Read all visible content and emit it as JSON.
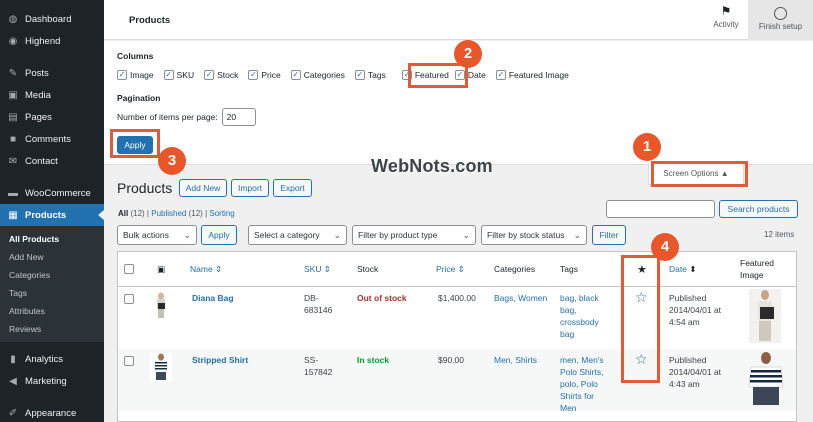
{
  "sidebar": {
    "items": [
      {
        "label": "Dashboard",
        "icon": "dashboard-icon"
      },
      {
        "label": "Highend",
        "icon": "palette-icon"
      },
      {
        "label": "Posts",
        "icon": "pin-icon"
      },
      {
        "label": "Media",
        "icon": "media-icon"
      },
      {
        "label": "Pages",
        "icon": "page-icon"
      },
      {
        "label": "Comments",
        "icon": "comment-icon"
      },
      {
        "label": "Contact",
        "icon": "mail-icon"
      },
      {
        "label": "WooCommerce",
        "icon": "woo-icon"
      },
      {
        "label": "Products",
        "icon": "box-icon"
      }
    ],
    "submenu": [
      "All Products",
      "Add New",
      "Categories",
      "Tags",
      "Attributes",
      "Reviews"
    ],
    "bottom_items": [
      {
        "label": "Analytics",
        "icon": "bar-chart-icon"
      },
      {
        "label": "Marketing",
        "icon": "megaphone-icon"
      },
      {
        "label": "Appearance",
        "icon": "brush-icon"
      }
    ]
  },
  "topbar": {
    "title": "Products",
    "activity": "Activity",
    "finish_setup": "Finish setup"
  },
  "screen_options": {
    "columns_heading": "Columns",
    "columns": [
      "Image",
      "SKU",
      "Stock",
      "Price",
      "Categories",
      "Tags",
      "Featured",
      "Date",
      "Featured Image"
    ],
    "pagination_heading": "Pagination",
    "per_page_label": "Number of items per page:",
    "per_page_value": "20",
    "apply": "Apply"
  },
  "annotations": [
    "1",
    "2",
    "3",
    "4"
  ],
  "watermark": "WebNots.com",
  "screen_options_tab": "Screen Options",
  "main": {
    "heading": "Products",
    "buttons": [
      "Add New",
      "Import",
      "Export"
    ],
    "filters": {
      "all": "All",
      "all_count": "(12)",
      "published": "Published",
      "published_count": "(12)",
      "sorting": "Sorting"
    },
    "search_button": "Search products",
    "bulk_actions": "Bulk actions",
    "apply": "Apply",
    "category_select": "Select a category",
    "type_select": "Filter by product type",
    "stock_select": "Filter by stock status",
    "filter_button": "Filter",
    "items_count": "12 items"
  },
  "table": {
    "headers": {
      "name": "Name",
      "sku": "SKU",
      "stock": "Stock",
      "price": "Price",
      "categories": "Categories",
      "tags": "Tags",
      "date": "Date",
      "featured_image_1": "Featured",
      "featured_image_2": "Image"
    },
    "rows": [
      {
        "name": "Diana Bag",
        "sku": [
          "DB-",
          "683146"
        ],
        "stock": "Out of stock",
        "stock_status": "out",
        "price": "$1,400.00",
        "categories": "Bags, Women",
        "tags": [
          "bag, black",
          "bag,",
          "crossbody",
          "bag"
        ],
        "date": [
          "Published",
          "2014/04/01 at",
          "4:54 am"
        ]
      },
      {
        "name": "Stripped Shirt",
        "sku": [
          "SS-",
          "157842"
        ],
        "stock": "In stock",
        "stock_status": "in",
        "price": "$90.00",
        "categories": "Men, Shirts",
        "tags": [
          "men, Men's",
          "Polo Shirts,",
          "polo, Polo",
          "Shirts for",
          "Men"
        ],
        "date": [
          "Published",
          "2014/04/01 at",
          "4:43 am"
        ]
      }
    ]
  },
  "colors": {
    "sidebar": "#1d2327",
    "accent": "#2271b1",
    "annotation": "#e8562a",
    "out_of_stock": "#b32d2e",
    "in_stock": "#00a32a"
  }
}
